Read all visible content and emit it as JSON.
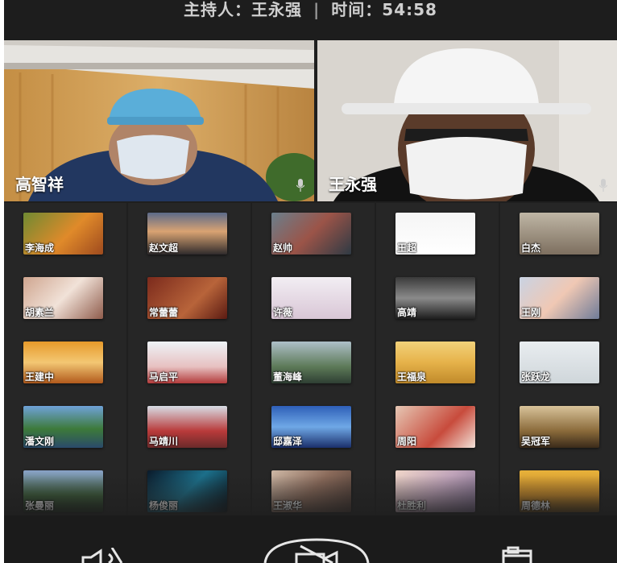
{
  "header": {
    "host_label": "主持人：王永强",
    "time_label": "时间：54:58"
  },
  "videos": [
    {
      "name": "高智祥"
    },
    {
      "name": "王永强"
    }
  ],
  "participants": [
    "李海成",
    "赵文超",
    "赵帅",
    "王超",
    "白杰",
    "胡素兰",
    "常蕾蕾",
    "许薇",
    "高靖",
    "王刚",
    "王建中",
    "马启平",
    "董海峰",
    "王福泉",
    "张跃龙",
    "潘文刚",
    "马靖川",
    "邸嘉泽",
    "周阳",
    "吴冠军",
    "张曼丽",
    "杨俊丽",
    "王淑华",
    "杜胜利",
    "周德林"
  ],
  "icons": {
    "mic": "microphone-icon",
    "speaker": "speaker-muted-icon",
    "camera": "camera-off-icon",
    "members": "members-icon"
  }
}
